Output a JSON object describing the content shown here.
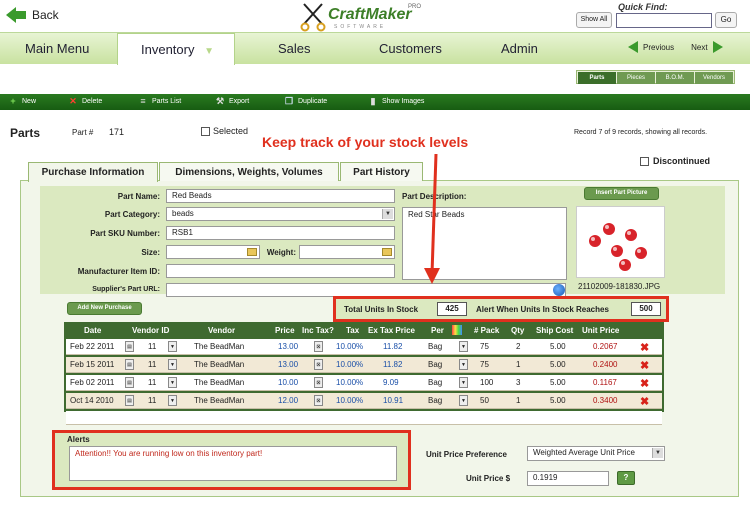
{
  "header": {
    "back_label": "Back",
    "logo_name": "CraftMaker",
    "logo_pro": "PRO",
    "logo_sub": "SOFTWARE",
    "show_all": "Show All",
    "quick_find_label": "Quick Find:",
    "quick_find_value": "",
    "go_label": "Go"
  },
  "nav": {
    "tabs": [
      "Main Menu",
      "Inventory",
      "Sales",
      "Customers",
      "Admin"
    ],
    "active": "Inventory",
    "previous": "Previous",
    "next": "Next"
  },
  "subtabs": [
    "Parts",
    "Pieces",
    "B.O.M.",
    "Vendors"
  ],
  "toolbar": {
    "new": "New",
    "delete": "Delete",
    "parts_list": "Parts List",
    "export": "Export",
    "duplicate": "Duplicate",
    "show_images": "Show Images"
  },
  "record": {
    "title": "Parts",
    "part_no_label": "Part #",
    "part_no": "171",
    "selected_label": "Selected",
    "record_status": "Record 7 of 9 records, showing all records.",
    "discontinued_label": "Discontinued"
  },
  "annotation": "Keep track of your stock levels",
  "detail_tabs": [
    "Purchase Information",
    "Dimensions, Weights, Volumes",
    "Part History"
  ],
  "form": {
    "part_name_label": "Part Name:",
    "part_name": "Red Beads",
    "category_label": "Part Category:",
    "category": "beads",
    "sku_label": "Part SKU Number:",
    "sku": "RSB1",
    "size_label": "Size:",
    "size": "",
    "weight_label": "Weight:",
    "weight": "",
    "mfr_label": "Manufacturer Item ID:",
    "mfr": "",
    "supplier_label": "Supplier's Part URL:",
    "supplier": "",
    "desc_label": "Part Description:",
    "desc": "Red Star Beads",
    "insert_picture": "Insert Part Picture",
    "picture_file": "21102009-181830.JPG",
    "add_new_purchase": "Add New Purchase"
  },
  "stock": {
    "total_label": "Total Units In Stock",
    "total": "425",
    "alert_label": "Alert When Units In Stock Reaches",
    "alert": "500"
  },
  "table": {
    "headers": [
      "Date",
      "Vendor ID",
      "Vendor",
      "Price",
      "Inc Tax?",
      "Tax",
      "Ex Tax Price",
      "Per",
      "# Pack",
      "Qty",
      "Ship Cost",
      "Unit Price"
    ],
    "rows": [
      {
        "date": "Feb 22 2011",
        "vendor_id": "11",
        "vendor": "The BeadMan",
        "price": "13.00",
        "tax": "10.00%",
        "ex_tax": "11.82",
        "per": "Bag",
        "pack": "75",
        "qty": "2",
        "ship": "5.00",
        "unit": "0.2067"
      },
      {
        "date": "Feb 15 2011",
        "vendor_id": "11",
        "vendor": "The BeadMan",
        "price": "13.00",
        "tax": "10.00%",
        "ex_tax": "11.82",
        "per": "Bag",
        "pack": "75",
        "qty": "1",
        "ship": "5.00",
        "unit": "0.2400"
      },
      {
        "date": "Feb 02 2011",
        "vendor_id": "11",
        "vendor": "The BeadMan",
        "price": "10.00",
        "tax": "10.00%",
        "ex_tax": "9.09",
        "per": "Bag",
        "pack": "100",
        "qty": "3",
        "ship": "5.00",
        "unit": "0.1167"
      },
      {
        "date": "Oct 14 2010",
        "vendor_id": "11",
        "vendor": "The BeadMan",
        "price": "12.00",
        "tax": "10.00%",
        "ex_tax": "10.91",
        "per": "Bag",
        "pack": "50",
        "qty": "1",
        "ship": "5.00",
        "unit": "0.3400"
      }
    ]
  },
  "alerts": {
    "label": "Alerts",
    "message": "Attention!! You are running low on this inventory part!"
  },
  "pricing": {
    "pref_label": "Unit Price Preference",
    "pref_value": "Weighted Average Unit Price",
    "unit_label": "Unit Price $",
    "unit_value": "0.1919",
    "help": "?"
  },
  "colors": {
    "accent_green": "#3a9a2c",
    "toolbar_green": "#1d6516",
    "annotation_red": "#e0301e"
  }
}
